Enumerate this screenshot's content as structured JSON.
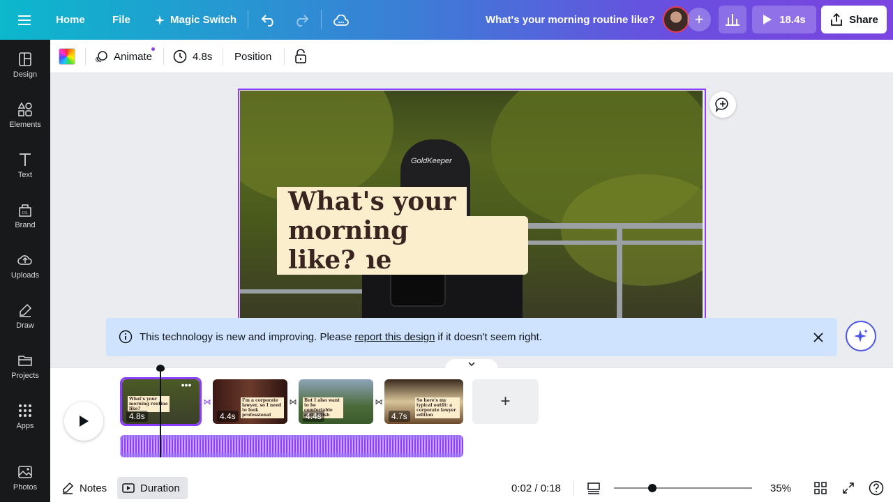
{
  "topbar": {
    "menu_icon": "hamburger-icon",
    "home_label": "Home",
    "file_label": "File",
    "magic_switch_label": "Magic Switch",
    "design_title": "What's your morning routine like?",
    "play_duration": "18.4s",
    "share_label": "Share"
  },
  "sidebar": {
    "items": [
      {
        "label": "Design",
        "icon": "design-icon"
      },
      {
        "label": "Elements",
        "icon": "elements-icon"
      },
      {
        "label": "Text",
        "icon": "text-icon"
      },
      {
        "label": "Brand",
        "icon": "brand-icon"
      },
      {
        "label": "Uploads",
        "icon": "uploads-icon"
      },
      {
        "label": "Draw",
        "icon": "draw-icon"
      },
      {
        "label": "Projects",
        "icon": "folder-icon"
      },
      {
        "label": "Apps",
        "icon": "apps-icon"
      },
      {
        "label": "Photos",
        "icon": "photos-icon"
      }
    ]
  },
  "context_toolbar": {
    "animate_label": "Animate",
    "duration_label": "4.8s",
    "position_label": "Position"
  },
  "canvas": {
    "headline": {
      "line1": "What's your",
      "line2": "morning routine",
      "line3": "like?"
    },
    "cap_logo": "GoldKeeper"
  },
  "notice": {
    "text_before": "This technology is new and improving. Please",
    "link_text": "report this design",
    "text_after": "if it doesn't seem right."
  },
  "timeline": {
    "clips": [
      {
        "duration": "4.8s",
        "caption": "What's your morning routine like?"
      },
      {
        "duration": "4.4s",
        "caption": "I'm a corporate lawyer, so I need to look professional"
      },
      {
        "duration": "4.4s",
        "caption": "But I also want to be comfortable and stylish"
      },
      {
        "duration": "4.7s",
        "caption": "So here's my typical outfit: a corporate lawyer edition"
      }
    ],
    "add_clip_icon": "plus-icon"
  },
  "bottombar": {
    "notes_label": "Notes",
    "duration_label": "Duration",
    "timecode": "0:02 / 0:18",
    "zoom_level": "35%",
    "zoom_fraction": 0.28
  },
  "colors": {
    "accent": "#8b3dff",
    "caption_bg": "#fbeecd",
    "caption_text": "#3a2420",
    "notice_bg": "#cfe3ff",
    "sidebar_bg": "#18191b"
  }
}
